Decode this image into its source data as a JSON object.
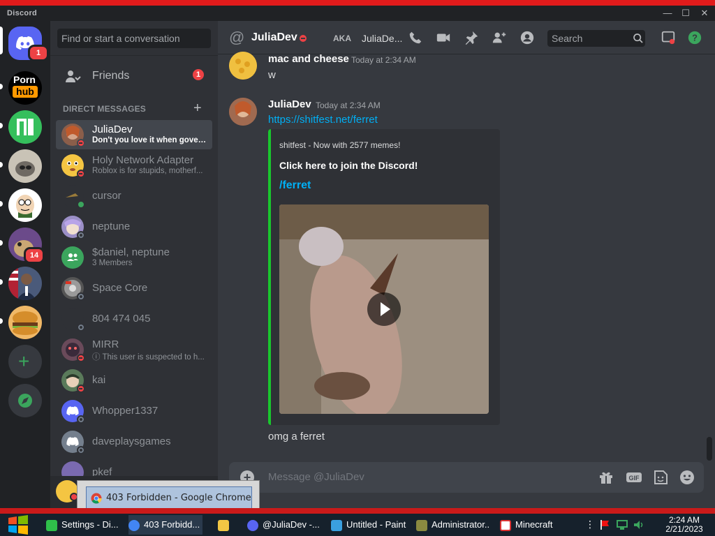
{
  "window": {
    "app_title": "Discord"
  },
  "servers": [
    {
      "name": "Direct Messages",
      "badge": "1"
    },
    {
      "name": "Porn hub",
      "logo_line1": "Porn",
      "logo_line2": "hub"
    },
    {
      "name": "Manjaro"
    },
    {
      "name": "Server raccoon"
    },
    {
      "name": "Peter Griffin"
    },
    {
      "name": "Server bird",
      "badge": "14"
    },
    {
      "name": "Server president"
    },
    {
      "name": "Server burger"
    }
  ],
  "dm_sidebar": {
    "search_placeholder": "Find or start a conversation",
    "friends_label": "Friends",
    "friends_badge": "1",
    "direct_messages_header": "DIRECT MESSAGES",
    "dms": [
      {
        "name": "JuliaDev",
        "sub": "Don't you love it when govern...",
        "status": "dnd",
        "selected": true
      },
      {
        "name": "Holy Network Adapter",
        "sub": "Roblox is for stupids, motherf...",
        "status": "dnd"
      },
      {
        "name": "cursor",
        "sub": "",
        "status": "online"
      },
      {
        "name": "neptune",
        "sub": "",
        "status": "offline"
      },
      {
        "name": "$daniel, neptune",
        "sub": "3 Members",
        "status": "group"
      },
      {
        "name": "Space Core",
        "sub": "",
        "status": "offline"
      },
      {
        "name": "804 474 045",
        "sub": "",
        "status": "offline"
      },
      {
        "name": "MIRR",
        "sub": "ⓘ This user is suspected to h...",
        "status": "dnd"
      },
      {
        "name": "kai",
        "sub": "",
        "status": "dnd"
      },
      {
        "name": "Whopper1337",
        "sub": "",
        "status": "offline"
      },
      {
        "name": "daveplaysgames",
        "sub": "",
        "status": "offline"
      },
      {
        "name": "pkef",
        "sub": "",
        "status": "offline"
      }
    ]
  },
  "chat": {
    "header": {
      "title": "JuliaDev",
      "aka_label": "AKA",
      "aka_name": "JuliaDe...",
      "search_placeholder": "Search"
    },
    "messages": [
      {
        "author": "mac and cheese",
        "timestamp": "Today at 2:34 AM",
        "text": "w"
      },
      {
        "author": "JuliaDev",
        "timestamp": "Today at 2:34 AM",
        "link": "https://shitfest.net/ferret",
        "embed": {
          "provider": "shitfest - Now with 2577 memes!",
          "title": "Click here to join the Discord!",
          "link_text": "/ferret"
        },
        "followup": "omg a ferret"
      }
    ],
    "composer_placeholder": "Message @JuliaDev"
  },
  "tooltip": {
    "text": "403 Forbidden - Google Chrome"
  },
  "taskbar": {
    "items": [
      {
        "label": "Settings - Di...",
        "icon_color": "#2fbf4a"
      },
      {
        "label": "403 Forbidd...",
        "icon_color": "#4285f4",
        "active": true
      },
      {
        "label": "",
        "icon_color": "#f2c744"
      },
      {
        "label": "@JuliaDev -...",
        "icon_color": "#5865f2"
      },
      {
        "label": "Untitled - Paint",
        "icon_color": "#3aa0e0"
      },
      {
        "label": "Administrator...",
        "icon_color": "#8a8a40"
      },
      {
        "label": "Minecraft",
        "icon_color": "#d33"
      }
    ],
    "time": "2:24 AM",
    "date": "2/21/2023"
  },
  "colors": {
    "accent": "#5865f2",
    "dnd": "#ed4245",
    "online": "#3ba55d",
    "link": "#00aff4",
    "embed_border": "#19c72d"
  }
}
